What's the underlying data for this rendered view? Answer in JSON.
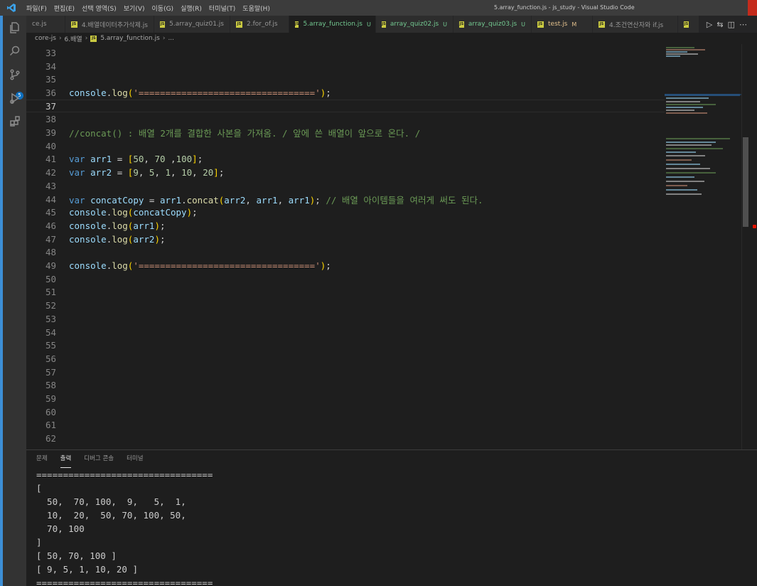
{
  "window": {
    "title": "5.array_function.js - js_study - Visual Studio Code",
    "app_icon": "vscode-logo-icon"
  },
  "menu": [
    "파일(F)",
    "편집(E)",
    "선택 영역(S)",
    "보기(V)",
    "이동(G)",
    "실행(R)",
    "터미널(T)",
    "도움말(H)"
  ],
  "activity_bar": {
    "items": [
      "explorer-icon",
      "search-icon",
      "source-control-icon",
      "run-debug-icon",
      "extensions-icon"
    ],
    "scm_badge": "5"
  },
  "tabs": [
    {
      "label": "ce.js",
      "icon": false,
      "state": "",
      "badge": ""
    },
    {
      "label": "4.배열데이터추가삭제.js",
      "icon": true,
      "state": "",
      "badge": ""
    },
    {
      "label": "5.array_quiz01.js",
      "icon": true,
      "state": "",
      "badge": ""
    },
    {
      "label": "2.for_of.js",
      "icon": true,
      "state": "",
      "badge": ""
    },
    {
      "label": "5.array_function.js",
      "icon": true,
      "state": "active-u",
      "badge": "U"
    },
    {
      "label": "array_quiz02.js",
      "icon": true,
      "state": "u",
      "badge": "U"
    },
    {
      "label": "array_quiz03.js",
      "icon": true,
      "state": "u",
      "badge": "U"
    },
    {
      "label": "test.js",
      "icon": true,
      "state": "m",
      "badge": "M"
    },
    {
      "label": "4.조건연산자와 if.js",
      "icon": true,
      "state": "",
      "badge": ""
    },
    {
      "label": "",
      "icon": true,
      "state": "",
      "badge": ""
    }
  ],
  "breadcrumb": [
    "core-js",
    "6.배열",
    "5.array_function.js",
    "..."
  ],
  "editor": {
    "current_line": 37,
    "lines": [
      {
        "n": 33,
        "tokens": []
      },
      {
        "n": 34,
        "tokens": []
      },
      {
        "n": 35,
        "tokens": []
      },
      {
        "n": 36,
        "tokens": [
          [
            "t-var",
            "console"
          ],
          [
            "t-plain",
            "."
          ],
          [
            "t-fn",
            "log"
          ],
          [
            "t-brk",
            "("
          ],
          [
            "t-str",
            "'================================='"
          ],
          [
            "t-brk",
            ")"
          ],
          [
            "t-plain",
            ";"
          ]
        ]
      },
      {
        "n": 37,
        "tokens": []
      },
      {
        "n": 38,
        "tokens": []
      },
      {
        "n": 39,
        "tokens": [
          [
            "t-comment",
            "//concat() : 배열 2개를 결합한 사본을 가져옴. / 앞에 쓴 배열이 앞으로 온다. /"
          ]
        ]
      },
      {
        "n": 40,
        "tokens": []
      },
      {
        "n": 41,
        "tokens": [
          [
            "t-kw",
            "var"
          ],
          [
            "t-plain",
            " "
          ],
          [
            "t-var",
            "arr1"
          ],
          [
            "t-plain",
            " = "
          ],
          [
            "t-brk",
            "["
          ],
          [
            "t-num",
            "50"
          ],
          [
            "t-plain",
            ", "
          ],
          [
            "t-num",
            "70"
          ],
          [
            "t-plain",
            " ,"
          ],
          [
            "t-num",
            "100"
          ],
          [
            "t-brk",
            "]"
          ],
          [
            "t-plain",
            ";"
          ]
        ]
      },
      {
        "n": 42,
        "tokens": [
          [
            "t-kw",
            "var"
          ],
          [
            "t-plain",
            " "
          ],
          [
            "t-var",
            "arr2"
          ],
          [
            "t-plain",
            " = "
          ],
          [
            "t-brk",
            "["
          ],
          [
            "t-num",
            "9"
          ],
          [
            "t-plain",
            ", "
          ],
          [
            "t-num",
            "5"
          ],
          [
            "t-plain",
            ", "
          ],
          [
            "t-num",
            "1"
          ],
          [
            "t-plain",
            ", "
          ],
          [
            "t-num",
            "10"
          ],
          [
            "t-plain",
            ", "
          ],
          [
            "t-num",
            "20"
          ],
          [
            "t-brk",
            "]"
          ],
          [
            "t-plain",
            ";"
          ]
        ]
      },
      {
        "n": 43,
        "tokens": []
      },
      {
        "n": 44,
        "tokens": [
          [
            "t-kw",
            "var"
          ],
          [
            "t-plain",
            " "
          ],
          [
            "t-var",
            "concatCopy"
          ],
          [
            "t-plain",
            " = "
          ],
          [
            "t-var",
            "arr1"
          ],
          [
            "t-plain",
            "."
          ],
          [
            "t-fn",
            "concat"
          ],
          [
            "t-brk",
            "("
          ],
          [
            "t-var",
            "arr2"
          ],
          [
            "t-plain",
            ", "
          ],
          [
            "t-var",
            "arr1"
          ],
          [
            "t-plain",
            ", "
          ],
          [
            "t-var",
            "arr1"
          ],
          [
            "t-brk",
            ")"
          ],
          [
            "t-plain",
            "; "
          ],
          [
            "t-comment",
            "// 배열 아이템들을 여러게 써도 된다."
          ]
        ]
      },
      {
        "n": 45,
        "tokens": [
          [
            "t-var",
            "console"
          ],
          [
            "t-plain",
            "."
          ],
          [
            "t-fn",
            "log"
          ],
          [
            "t-brk",
            "("
          ],
          [
            "t-var",
            "concatCopy"
          ],
          [
            "t-brk",
            ")"
          ],
          [
            "t-plain",
            ";"
          ]
        ]
      },
      {
        "n": 46,
        "tokens": [
          [
            "t-var",
            "console"
          ],
          [
            "t-plain",
            "."
          ],
          [
            "t-fn",
            "log"
          ],
          [
            "t-brk",
            "("
          ],
          [
            "t-var",
            "arr1"
          ],
          [
            "t-brk",
            ")"
          ],
          [
            "t-plain",
            ";"
          ]
        ]
      },
      {
        "n": 47,
        "tokens": [
          [
            "t-var",
            "console"
          ],
          [
            "t-plain",
            "."
          ],
          [
            "t-fn",
            "log"
          ],
          [
            "t-brk",
            "("
          ],
          [
            "t-var",
            "arr2"
          ],
          [
            "t-brk",
            ")"
          ],
          [
            "t-plain",
            ";"
          ]
        ]
      },
      {
        "n": 48,
        "tokens": []
      },
      {
        "n": 49,
        "tokens": [
          [
            "t-var",
            "console"
          ],
          [
            "t-plain",
            "."
          ],
          [
            "t-fn",
            "log"
          ],
          [
            "t-brk",
            "("
          ],
          [
            "t-str",
            "'================================='"
          ],
          [
            "t-brk",
            ")"
          ],
          [
            "t-plain",
            ";"
          ]
        ]
      },
      {
        "n": 50,
        "tokens": []
      },
      {
        "n": 51,
        "tokens": []
      },
      {
        "n": 52,
        "tokens": []
      },
      {
        "n": 53,
        "tokens": []
      },
      {
        "n": 54,
        "tokens": []
      },
      {
        "n": 55,
        "tokens": []
      },
      {
        "n": 56,
        "tokens": []
      },
      {
        "n": 57,
        "tokens": []
      },
      {
        "n": 58,
        "tokens": []
      },
      {
        "n": 59,
        "tokens": []
      },
      {
        "n": 60,
        "tokens": []
      },
      {
        "n": 61,
        "tokens": []
      },
      {
        "n": 62,
        "tokens": []
      }
    ]
  },
  "panel": {
    "tabs": [
      {
        "label": "문제",
        "active": false
      },
      {
        "label": "출력",
        "active": true
      },
      {
        "label": "디버그 콘솔",
        "active": false
      },
      {
        "label": "터미널",
        "active": false
      }
    ],
    "output": [
      "=================================",
      "[",
      "  50,  70, 100,  9,   5,  1,",
      "  10,  20,  50, 70, 100, 50,",
      "  70, 100",
      "]",
      "[ 50, 70, 100 ]",
      "[ 9, 5, 1, 10, 20 ]",
      "================================="
    ]
  },
  "colors": {
    "accent": "#3d8fd6",
    "untracked": "#73c991",
    "modified": "#e2c08d",
    "error_marker": "#e51400"
  }
}
